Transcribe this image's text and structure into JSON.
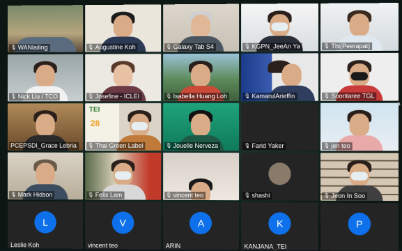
{
  "participants": [
    {
      "name": "WANlailing"
    },
    {
      "name": "Augustine Koh"
    },
    {
      "name": "Galaxy Tab S4"
    },
    {
      "name": "KGPN_JeeAn Ya"
    },
    {
      "name": "Thi(Peerapat)"
    },
    {
      "name": "Nick Liu / TCO"
    },
    {
      "name": "Josefine - ICLEI"
    },
    {
      "name": "Isabella Huang Loh"
    },
    {
      "name": "KamarulArieffin"
    },
    {
      "name": "Soontaree TGL"
    },
    {
      "name": "PCEPSDI_Grace Lebria"
    },
    {
      "name": "Thai Green Label"
    },
    {
      "name": "Jouelle Nerveza"
    },
    {
      "name": "Farid Yaker"
    },
    {
      "name": "jen teo"
    },
    {
      "name": "Mark Hidson"
    },
    {
      "name": "Felix Lam"
    },
    {
      "name": "vincent teo"
    },
    {
      "name": "shashi"
    },
    {
      "name": "Jeon In Soo"
    }
  ],
  "avatars": [
    {
      "initial": "L",
      "name": "Leslie Koh"
    },
    {
      "initial": "V",
      "name": "vincent teo"
    },
    {
      "initial": "A",
      "name": "ARIN"
    },
    {
      "initial": "K",
      "name": "KANJANA_TEI"
    },
    {
      "initial": "P",
      "name": ""
    }
  ],
  "tei_logo": "TEI",
  "tei_years": "28",
  "colors": {
    "avatar_bg": "#0e71eb",
    "background": "#0e1a17"
  }
}
